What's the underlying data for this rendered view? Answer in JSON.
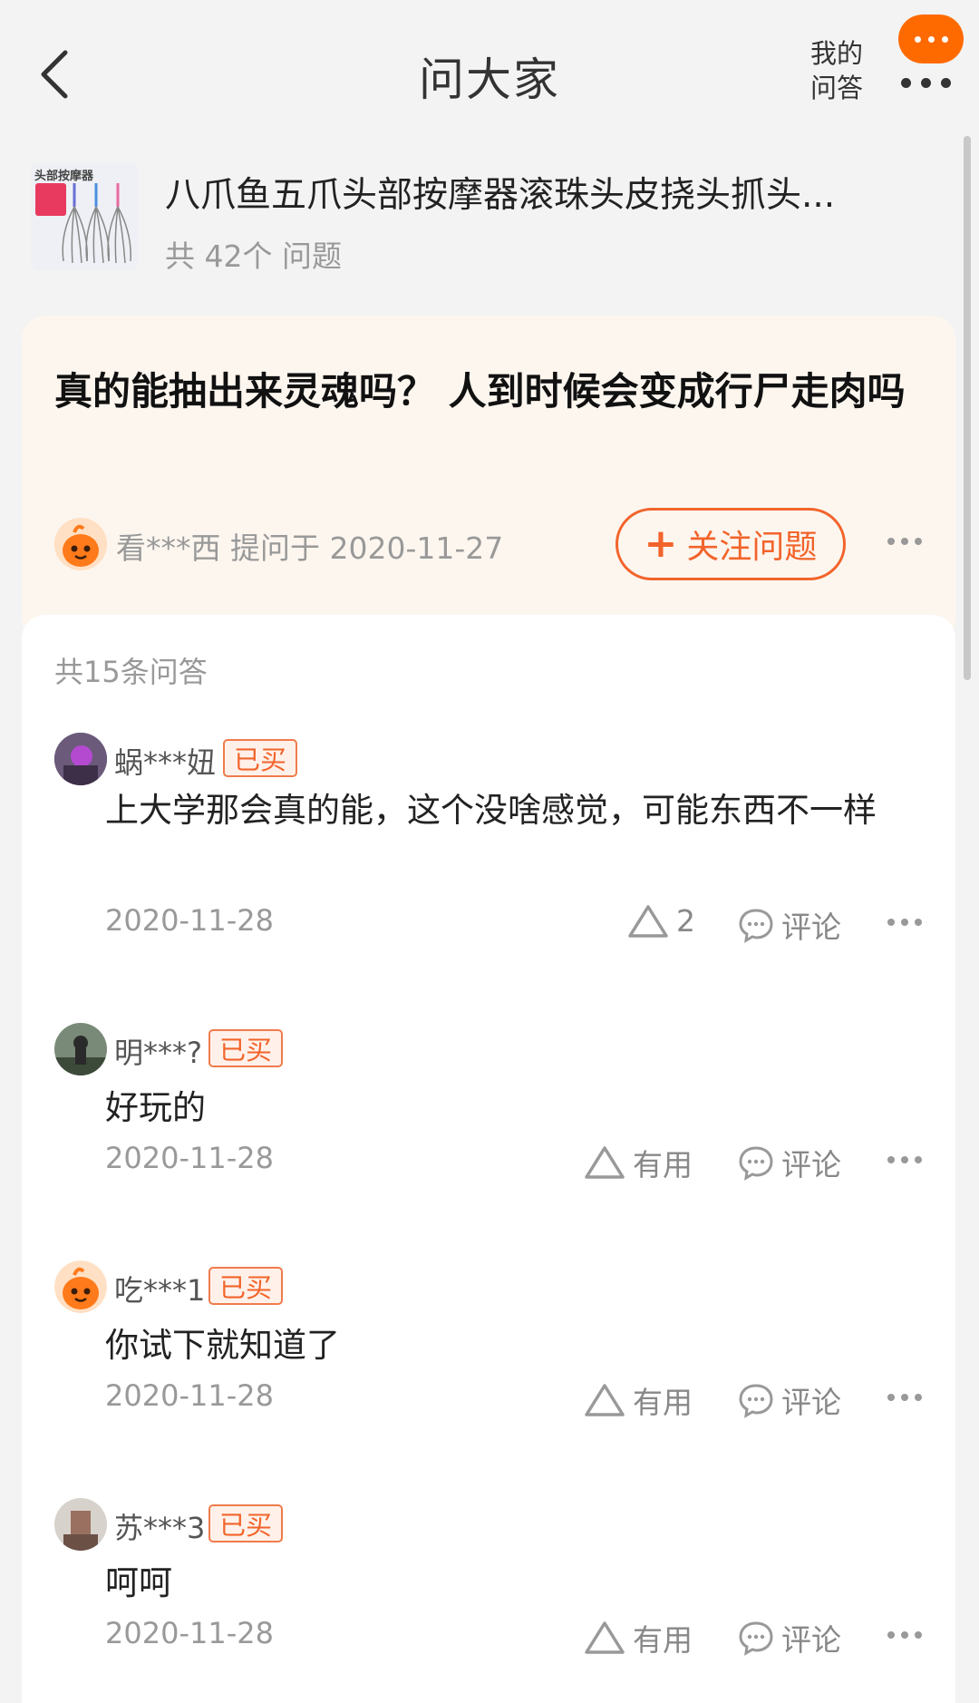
{
  "header": {
    "title": "问大家",
    "my_qa_line1": "我的",
    "my_qa_line2": "问答"
  },
  "product": {
    "name": "八爪鱼五爪头部按摩器滚珠头皮挠头抓头...",
    "count": "共 42个 问题",
    "thumb_label": "头部按摩器"
  },
  "question": {
    "title": "真的能抽出来灵魂吗？ 人到时候会变成行尸走肉吗",
    "asker": "看***西",
    "asked_at": "提问于 2020-11-27",
    "follow_label": "关注问题"
  },
  "answers_section": {
    "count_label": "共15条问答",
    "items": [
      {
        "user": "蜗***妞",
        "badge": "已买",
        "text": "上大学那会真的能，这个没啥感觉，可能东西不一样",
        "date": "2020-11-28",
        "useful": "2",
        "comment": "评论"
      },
      {
        "user": "明***?",
        "badge": "已买",
        "text": "好玩的",
        "date": "2020-11-28",
        "useful": "有用",
        "comment": "评论"
      },
      {
        "user": "吃***1",
        "badge": "已买",
        "text": "你试下就知道了",
        "date": "2020-11-28",
        "useful": "有用",
        "comment": "评论"
      },
      {
        "user": "苏***3",
        "badge": "已买",
        "text": "呵呵",
        "date": "2020-11-28",
        "useful": "有用",
        "comment": "评论"
      }
    ]
  },
  "colors": {
    "accent": "#f2642b",
    "menu_bubble": "#ff6a00",
    "card_bg": "#fdf6ef"
  }
}
